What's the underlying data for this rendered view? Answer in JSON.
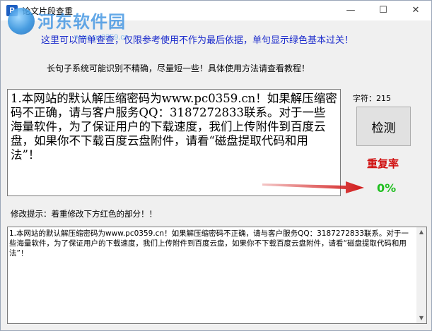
{
  "window": {
    "title": "论文片段查重",
    "minimize_glyph": "—",
    "maximize_glyph": "☐",
    "close_glyph": "✕"
  },
  "watermark": {
    "brand": "河东软件园",
    "url": "www.pc0359.cn"
  },
  "notices": {
    "line1": "这里可以简单查查，仅限参考使用不作为最后依据，单句显示绿色基本过关！",
    "line2": "长句子系统可能识别不精确，尽量短一些！具体使用方法请查看教程！"
  },
  "input": {
    "text": "1.本网站的默认解压缩密码为www.pc0359.cn！如果解压缩密码不正确，请与客户服务QQ：3187272833联系。对于一些海量软件，为了保证用户的下载速度，我们上传附件到百度云盘，如果你不下载百度云盘附件，请看“磁盘提取代码和用法”！"
  },
  "stats": {
    "char_count_label": "字符：215",
    "check_button": "检测",
    "rate_label": "重复率",
    "rate_value": "0%"
  },
  "hint": "修改提示：着重修改下方红色的部分！！",
  "result": {
    "text": "1.本网站的默认解压缩密码为www.pc0359.cn！如果解压缩密码不正确，请与客户服务QQ：3187272833联系。对于一些海量软件，为了保证用户的下载速度，我们上传附件到百度云盘，如果你不下载百度云盘附件，请看“磁盘提取代码和用法”！"
  },
  "colors": {
    "notice_blue": "#1a2acc",
    "rate_red": "#d01010",
    "rate_green": "#1fbf1f",
    "arrow_red": "#d21a1a"
  },
  "icons": {
    "app": "app-icon",
    "arrow": "red-arrow-icon"
  }
}
